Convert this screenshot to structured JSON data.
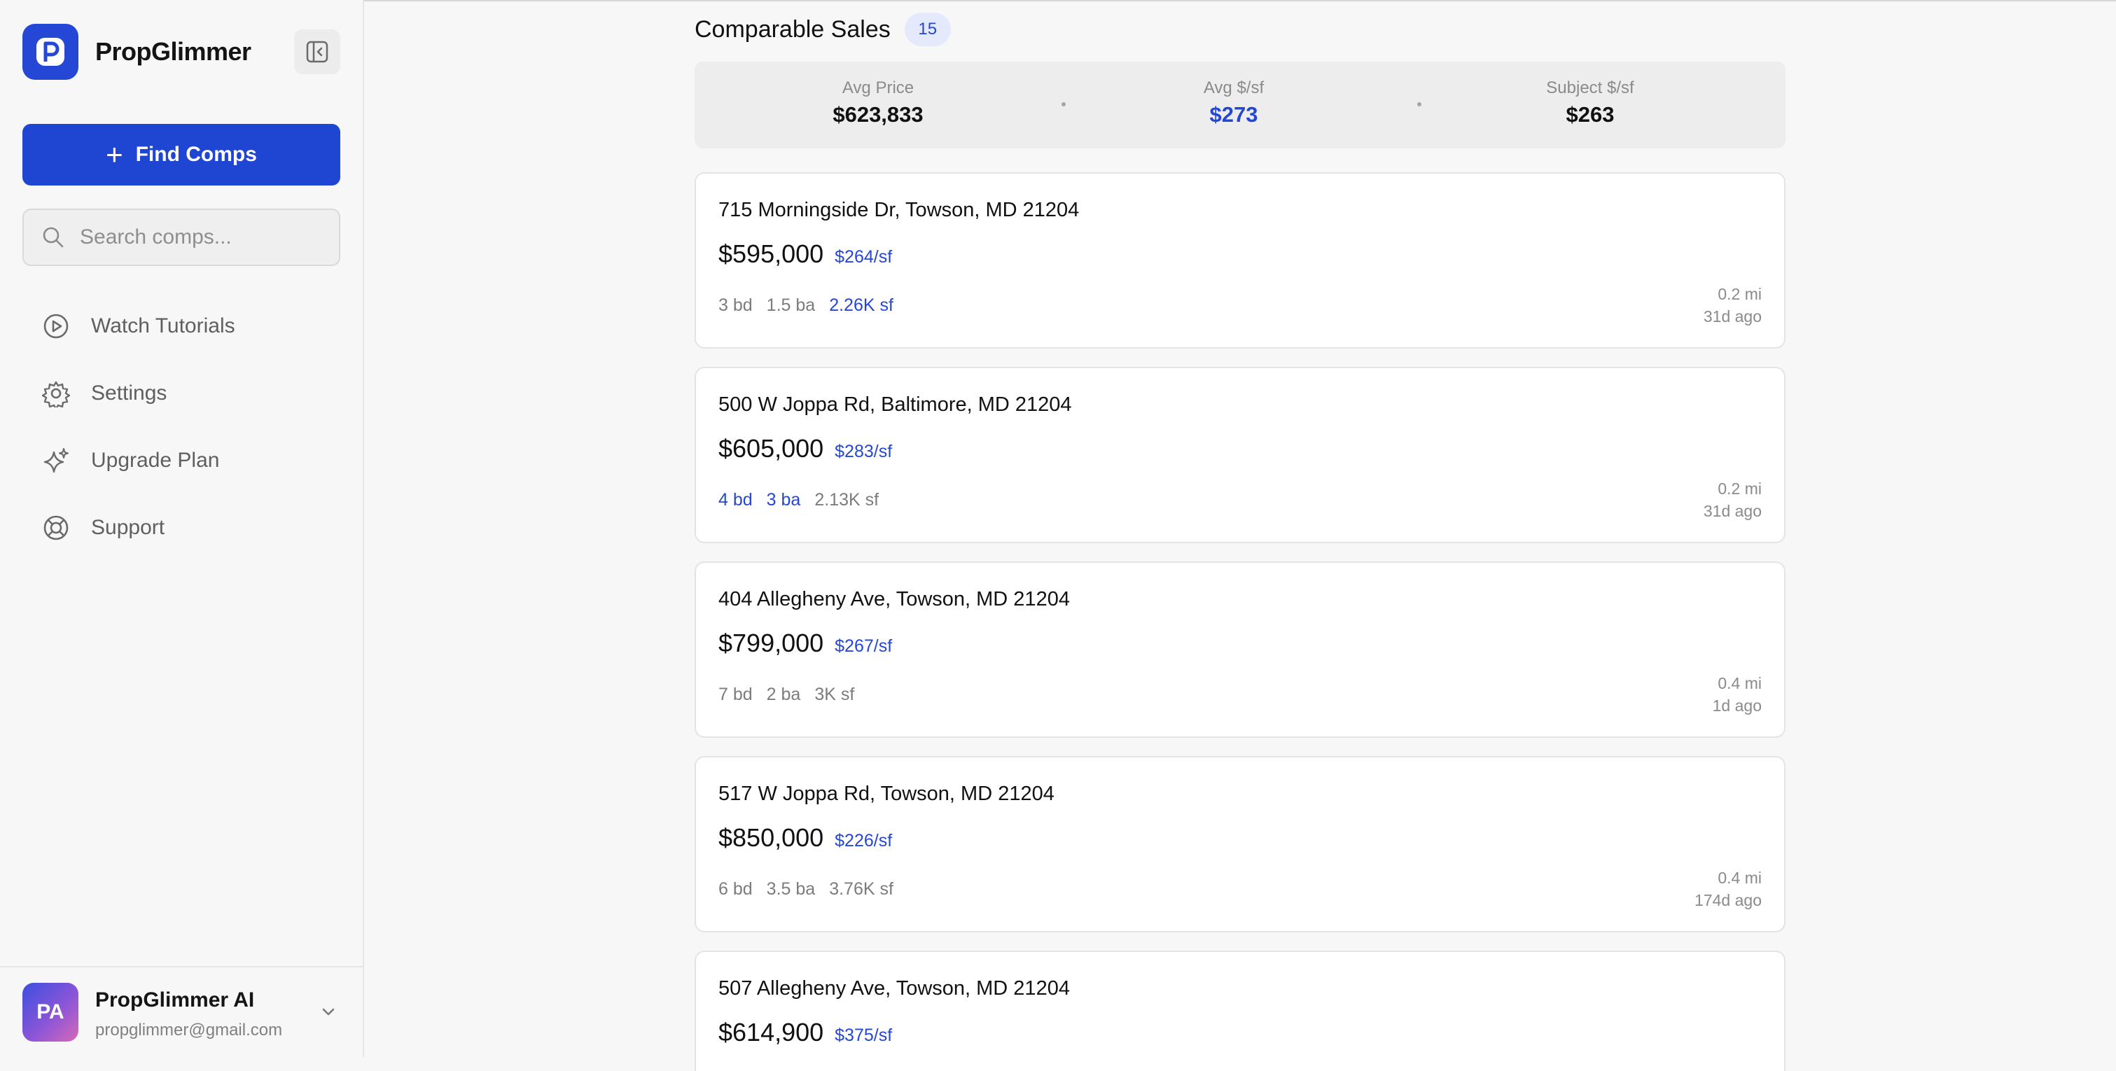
{
  "app": {
    "brand": "PropGlimmer",
    "logo_letter": "P",
    "brand_color": "#2447d6"
  },
  "sidebar": {
    "find_comps_label": "Find Comps",
    "search_placeholder": "Search comps...",
    "items": [
      {
        "label": "Watch Tutorials",
        "icon": "play-circle-icon"
      },
      {
        "label": "Settings",
        "icon": "gear-icon"
      },
      {
        "label": "Upgrade Plan",
        "icon": "sparkles-icon"
      },
      {
        "label": "Support",
        "icon": "lifebuoy-icon"
      }
    ],
    "account": {
      "initials": "PA",
      "name": "PropGlimmer AI",
      "email": "propglimmer@gmail.com"
    }
  },
  "main": {
    "title": "Comparable Sales",
    "count": "15",
    "summary": {
      "avg_price_label": "Avg Price",
      "avg_price": "$623,833",
      "avg_psf_label": "Avg $/sf",
      "avg_psf": "$273",
      "subject_psf_label": "Subject $/sf",
      "subject_psf": "$263"
    },
    "comps": [
      {
        "address": "715 Morningside Dr, Towson, MD 21204",
        "price": "$595,000",
        "ppsf": "$264/sf",
        "beds": "3 bd",
        "baths": "1.5 ba",
        "sqft": "2.26K sf",
        "highlight": [
          "sqft"
        ],
        "distance": "0.2 mi",
        "age": "31d ago"
      },
      {
        "address": "500 W Joppa Rd, Baltimore, MD 21204",
        "price": "$605,000",
        "ppsf": "$283/sf",
        "beds": "4 bd",
        "baths": "3 ba",
        "sqft": "2.13K sf",
        "highlight": [
          "beds",
          "baths"
        ],
        "distance": "0.2 mi",
        "age": "31d ago"
      },
      {
        "address": "404 Allegheny Ave, Towson, MD 21204",
        "price": "$799,000",
        "ppsf": "$267/sf",
        "beds": "7 bd",
        "baths": "2 ba",
        "sqft": "3K sf",
        "highlight": [],
        "distance": "0.4 mi",
        "age": "1d ago"
      },
      {
        "address": "517 W Joppa Rd, Towson, MD 21204",
        "price": "$850,000",
        "ppsf": "$226/sf",
        "beds": "6 bd",
        "baths": "3.5 ba",
        "sqft": "3.76K sf",
        "highlight": [],
        "distance": "0.4 mi",
        "age": "174d ago"
      },
      {
        "address": "507 Allegheny Ave, Towson, MD 21204",
        "price": "$614,900",
        "ppsf": "$375/sf"
      }
    ]
  }
}
